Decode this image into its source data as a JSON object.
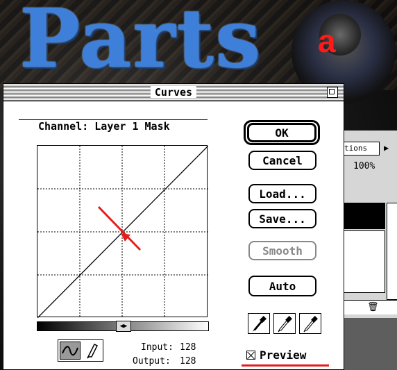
{
  "banner": {
    "title": "Parts",
    "figure_letter": "a"
  },
  "dialog": {
    "title": "Curves",
    "channel_label": "Channel:",
    "channel_value": "Layer 1 Mask",
    "buttons": {
      "ok": "OK",
      "cancel": "Cancel",
      "load": "Load...",
      "save": "Save...",
      "smooth": "Smooth",
      "auto": "Auto"
    },
    "input_label": "Input:",
    "input_value": "128",
    "output_label": "Output:",
    "output_value": "128",
    "preview_label": "Preview",
    "preview_checked": true,
    "annotation_color": "#e51d1d"
  },
  "side_panel": {
    "tab_label": "tions",
    "zoom": "100%"
  }
}
